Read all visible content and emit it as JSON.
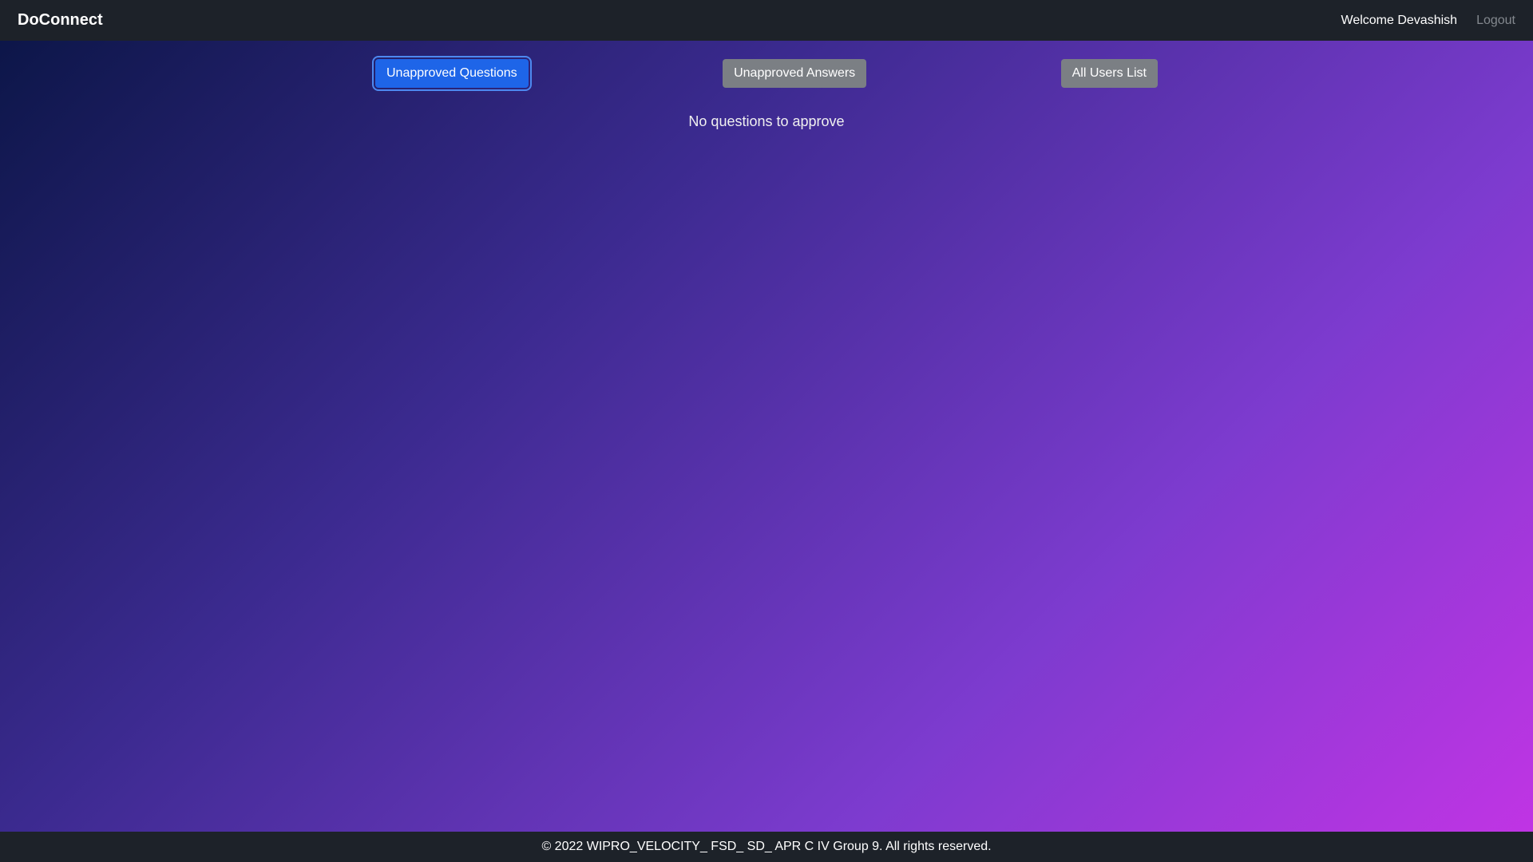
{
  "navbar": {
    "brand": "DoConnect",
    "welcome": "Welcome Devashish",
    "logout": "Logout"
  },
  "tabs": {
    "unapproved_questions": "Unapproved Questions",
    "unapproved_answers": "Unapproved Answers",
    "all_users": "All Users List"
  },
  "main": {
    "empty_message": "No questions to approve"
  },
  "footer": {
    "text": "© 2022 WIPRO_VELOCITY_ FSD_ SD_ APR C IV Group 9. All rights reserved."
  }
}
